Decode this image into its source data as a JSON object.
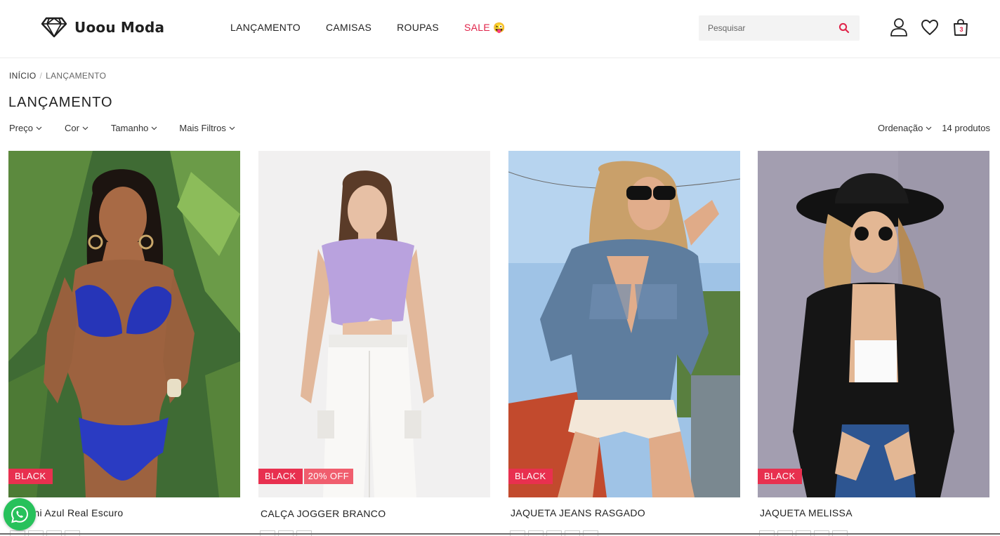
{
  "header": {
    "brand": "Uoou Moda",
    "nav": [
      {
        "label": "LANÇAMENTO"
      },
      {
        "label": "CAMISAS"
      },
      {
        "label": "ROUPAS"
      },
      {
        "label": "SALE 😜"
      }
    ],
    "search_placeholder": "Pesquisar",
    "cart_count": "3"
  },
  "breadcrumb": {
    "home": "INÍCIO",
    "current": "LANÇAMENTO"
  },
  "page_title": "LANÇAMENTO",
  "filters": [
    "Preço",
    "Cor",
    "Tamanho",
    "Mais Filtros"
  ],
  "sort_label": "Ordenação",
  "product_count": "14 produtos",
  "products": [
    {
      "name": "Biquíni Azul Real Escuro",
      "badge": "BLACK",
      "discount": ""
    },
    {
      "name": "CALÇA JOGGER BRANCO",
      "badge": "BLACK",
      "discount": "20% OFF"
    },
    {
      "name": "JAQUETA JEANS RASGADO",
      "badge": "BLACK",
      "discount": ""
    },
    {
      "name": "JAQUETA MELISSA",
      "badge": "BLACK",
      "discount": ""
    }
  ],
  "colors": {
    "accent": "#e8304f",
    "sale": "#e0244a",
    "whatsapp": "#27c15b"
  }
}
